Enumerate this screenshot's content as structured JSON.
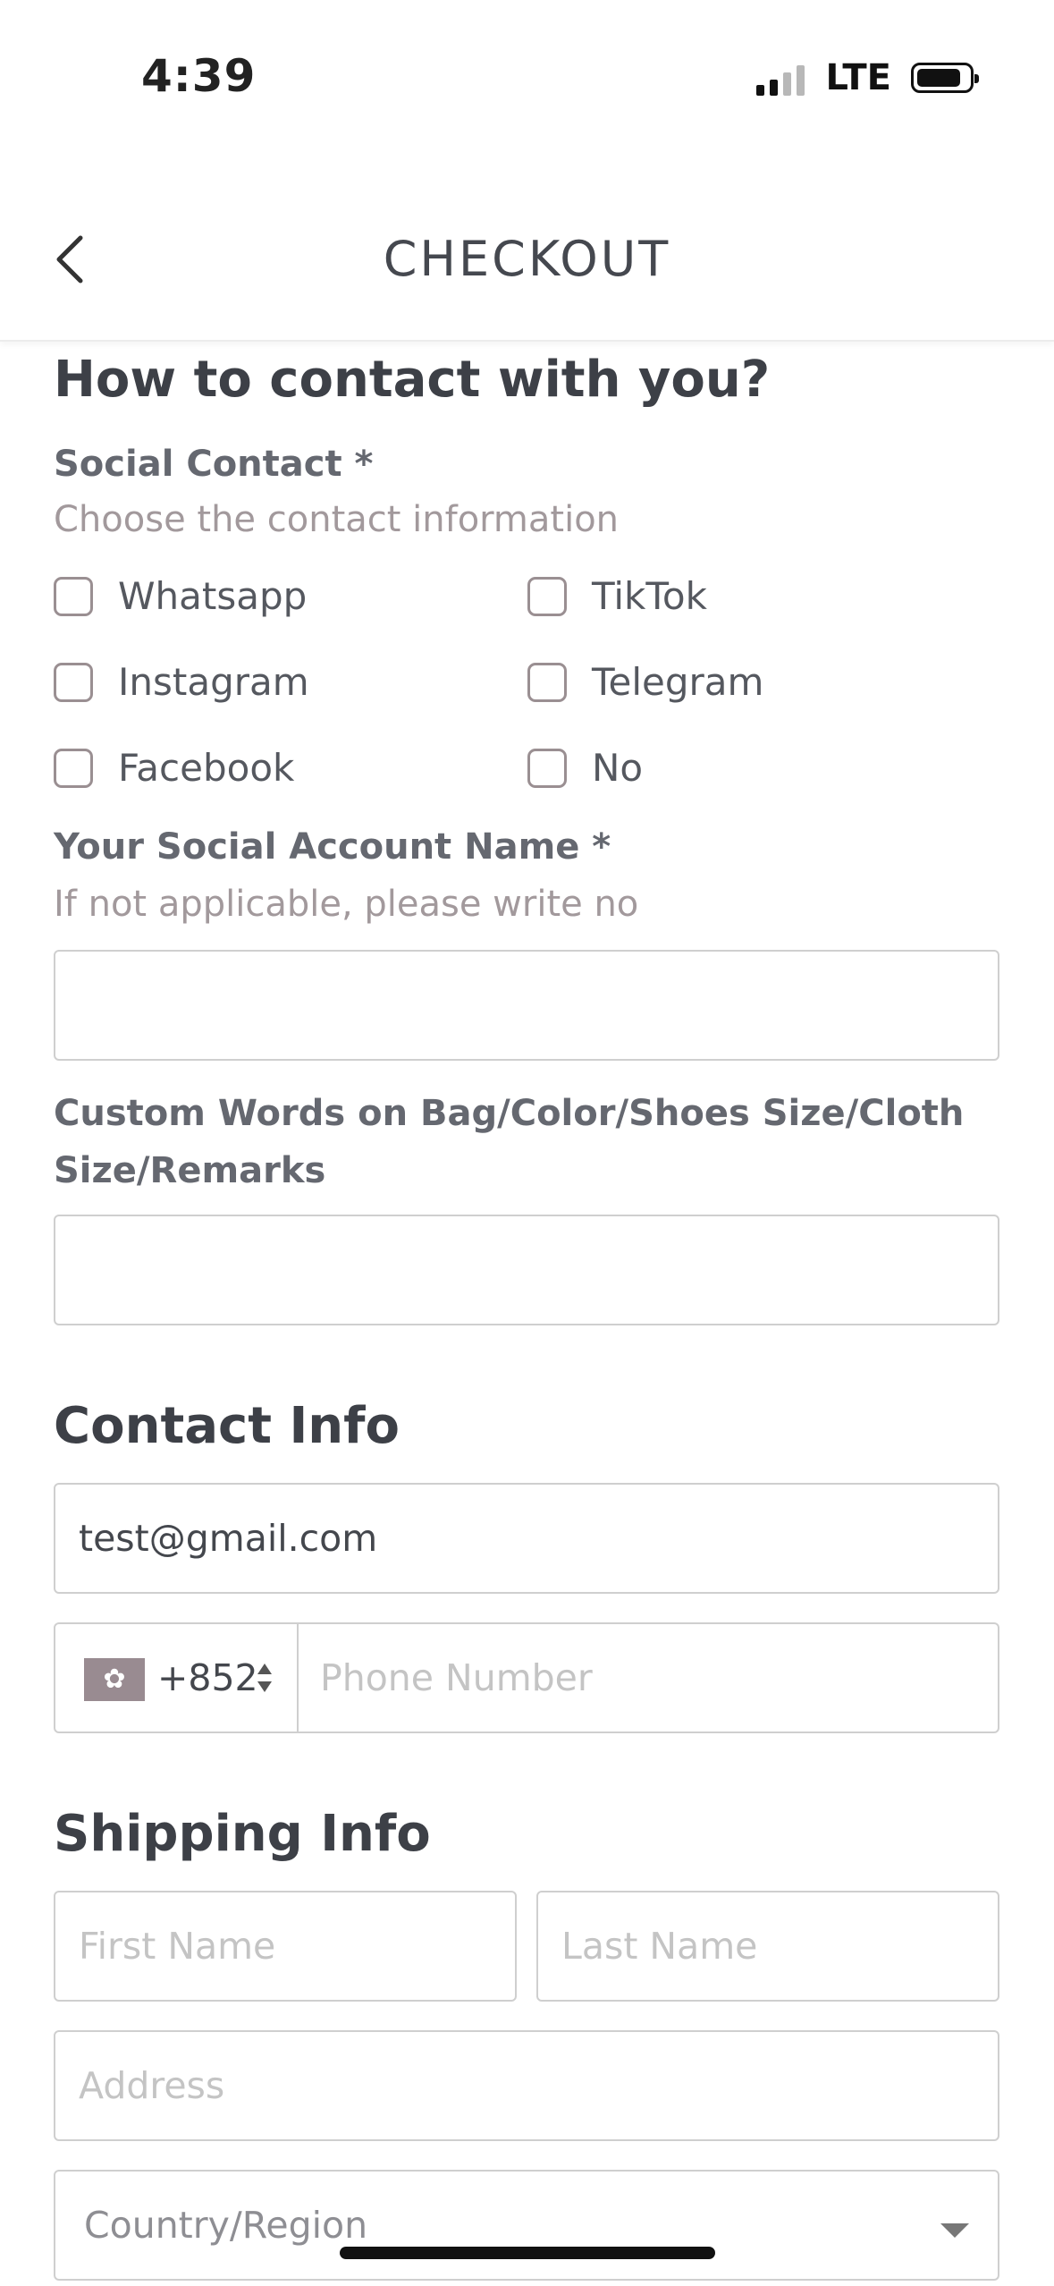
{
  "status_bar": {
    "time": "4:39",
    "network": "LTE"
  },
  "header": {
    "title": "CHECKOUT"
  },
  "contact_section": {
    "heading": "How to contact with you?",
    "social_label": "Social Contact *",
    "social_hint": "Choose the contact information",
    "options": [
      "Whatsapp",
      "TikTok",
      "Instagram",
      "Telegram",
      "Facebook",
      "No"
    ],
    "account_label": "Your Social Account Name *",
    "account_hint": "If not applicable, please write no",
    "account_value": "",
    "custom_label_line1": "Custom Words on Bag/Color/Shoes Size/Cloth",
    "custom_label_line2": "Size/Remarks",
    "custom_value": ""
  },
  "contact_info": {
    "heading": "Contact Info",
    "email_value": "test@gmail.com",
    "country_code": "+852",
    "phone_placeholder": "Phone Number"
  },
  "shipping_info": {
    "heading": "Shipping Info",
    "first_name_placeholder": "First Name",
    "last_name_placeholder": "Last Name",
    "address_placeholder": "Address",
    "country_placeholder": "Country/Region"
  }
}
